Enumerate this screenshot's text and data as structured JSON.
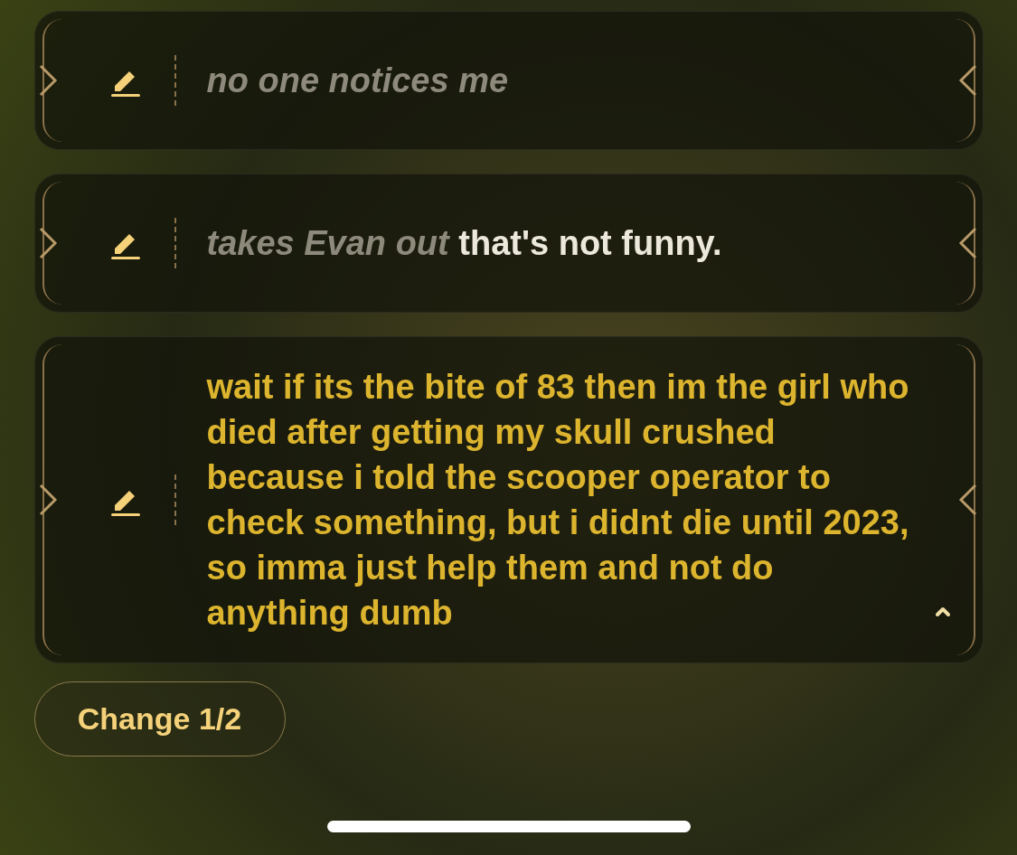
{
  "options": [
    {
      "segments": [
        {
          "kind": "action",
          "text": "no one notices me"
        }
      ],
      "expanded": false
    },
    {
      "segments": [
        {
          "kind": "action",
          "text": "takes Evan out"
        },
        {
          "kind": "speech",
          "text": "that's not funny."
        }
      ],
      "expanded": false
    },
    {
      "segments": [
        {
          "kind": "speech",
          "text": "wait if its the bite of 83 then im the girl who died after getting my skull crushed because i told the scooper operator to check something, but i didnt die until 2023, so imma just help them and not do anything dumb"
        }
      ],
      "expanded": true
    }
  ],
  "change_button": {
    "label": "Change 1/2"
  }
}
